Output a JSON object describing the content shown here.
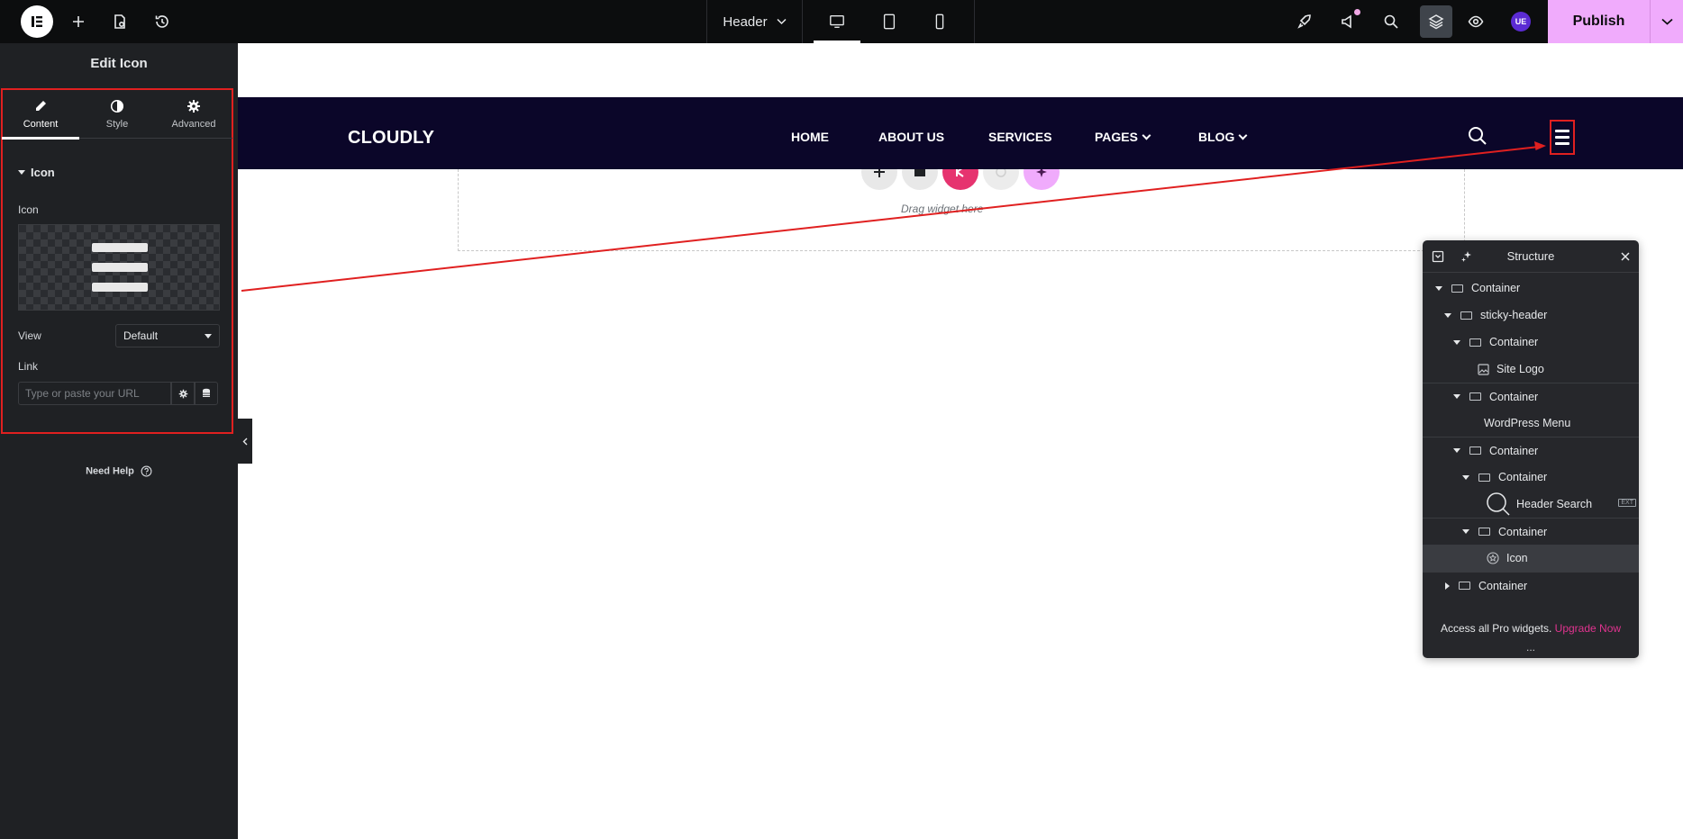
{
  "topbar": {
    "document_title": "Header",
    "publish_label": "Publish",
    "user_badge": "UE",
    "icons": [
      "elementor-logo-icon",
      "add-element-icon",
      "page-settings-icon",
      "history-icon",
      "rocket-icon",
      "announcements-icon",
      "search-icon",
      "structure-layers-icon",
      "preview-eye-icon",
      "user-avatar-icon",
      "chevron-down-icon"
    ],
    "devices": [
      "desktop",
      "tablet",
      "mobile"
    ]
  },
  "panel": {
    "title": "Edit Icon",
    "tabs": [
      {
        "label": "Content",
        "icon": "pencil-icon",
        "active": true
      },
      {
        "label": "Style",
        "icon": "half-circle-icon",
        "active": false
      },
      {
        "label": "Advanced",
        "icon": "gear-icon",
        "active": false
      }
    ],
    "section_title": "Icon",
    "icon_label": "Icon",
    "view_label": "View",
    "view_value": "Default",
    "link_label": "Link",
    "link_placeholder": "Type or paste your URL",
    "need_help": "Need Help"
  },
  "canvas": {
    "site_logo": "CLOUDLY",
    "menu": [
      {
        "label": "HOME",
        "dropdown": false
      },
      {
        "label": "ABOUT US",
        "dropdown": false
      },
      {
        "label": "SERVICES",
        "dropdown": false
      },
      {
        "label": "PAGES",
        "dropdown": true
      },
      {
        "label": "BLOG",
        "dropdown": true
      }
    ],
    "drop_text": "Drag widget here"
  },
  "structure": {
    "title": "Structure",
    "rows": [
      {
        "label": "Container",
        "level": 0,
        "kind": "container",
        "expanded": true
      },
      {
        "label": "sticky-header",
        "level": 1,
        "kind": "container",
        "expanded": true
      },
      {
        "label": "Container",
        "level": 2,
        "kind": "container",
        "expanded": true
      },
      {
        "label": "Site Logo",
        "level": 3,
        "kind": "image"
      },
      {
        "label": "Container",
        "level": 2,
        "kind": "container",
        "expanded": true,
        "sep": true
      },
      {
        "label": "WordPress Menu",
        "level": 3,
        "kind": "none"
      },
      {
        "label": "Container",
        "level": 2,
        "kind": "container",
        "expanded": true,
        "sep": true
      },
      {
        "label": "Container",
        "level": 3,
        "kind": "container",
        "expanded": true
      },
      {
        "label": "Header Search",
        "level": 4,
        "kind": "search",
        "badge": "EXT"
      },
      {
        "label": "Container",
        "level": 3,
        "kind": "container",
        "expanded": true,
        "sep": true
      },
      {
        "label": "Icon",
        "level": 4,
        "kind": "star",
        "selected": true
      },
      {
        "label": "Container",
        "level": 1,
        "kind": "container",
        "expanded": false,
        "sep": true
      }
    ],
    "footer_text": "Access all Pro widgets.",
    "footer_link": "Upgrade Now",
    "grip": "..."
  },
  "colors": {
    "publish": "#f0abfc",
    "site_header": "#0b0629",
    "highlight": "#e02020",
    "upgrade_link": "#e0338f"
  }
}
